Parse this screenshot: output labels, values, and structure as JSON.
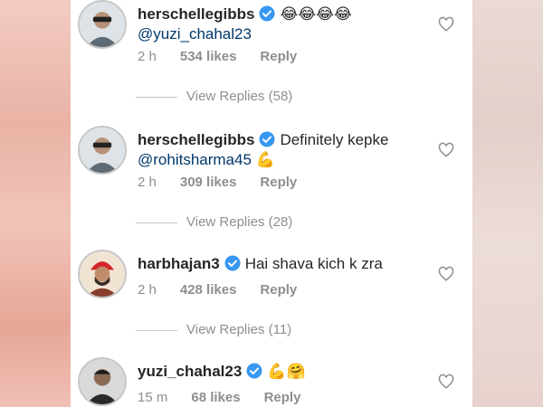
{
  "comments": [
    {
      "username": "herschellegibbs",
      "text": "😂😂😂😂",
      "mention": "@yuzi_chahal23",
      "time": "2 h",
      "likes": "534 likes",
      "reply": "Reply",
      "view_replies": "View Replies (58)",
      "avatar_icon": "person-avatar-icon"
    },
    {
      "username": "herschellegibbs",
      "text": "Definitely kepke",
      "mention": "@rohitsharma45",
      "mention_emoji": "💪",
      "time": "2 h",
      "likes": "309 likes",
      "reply": "Reply",
      "view_replies": "View Replies (28)",
      "avatar_icon": "person-avatar-icon"
    },
    {
      "username": "harbhajan3",
      "text": "Hai shava kich k zra",
      "time": "2 h",
      "likes": "428 likes",
      "reply": "Reply",
      "view_replies": "View Replies (11)",
      "avatar_icon": "turban-avatar-icon"
    },
    {
      "username": "yuzi_chahal23",
      "text": "💪🤗",
      "time": "15 m",
      "likes": "68 likes",
      "reply": "Reply",
      "avatar_icon": "person-avatar-icon"
    }
  ],
  "colors": {
    "verified_badge": "#3897f0",
    "username": "#262626",
    "mention": "#00376b",
    "meta": "#8e8e8e"
  }
}
